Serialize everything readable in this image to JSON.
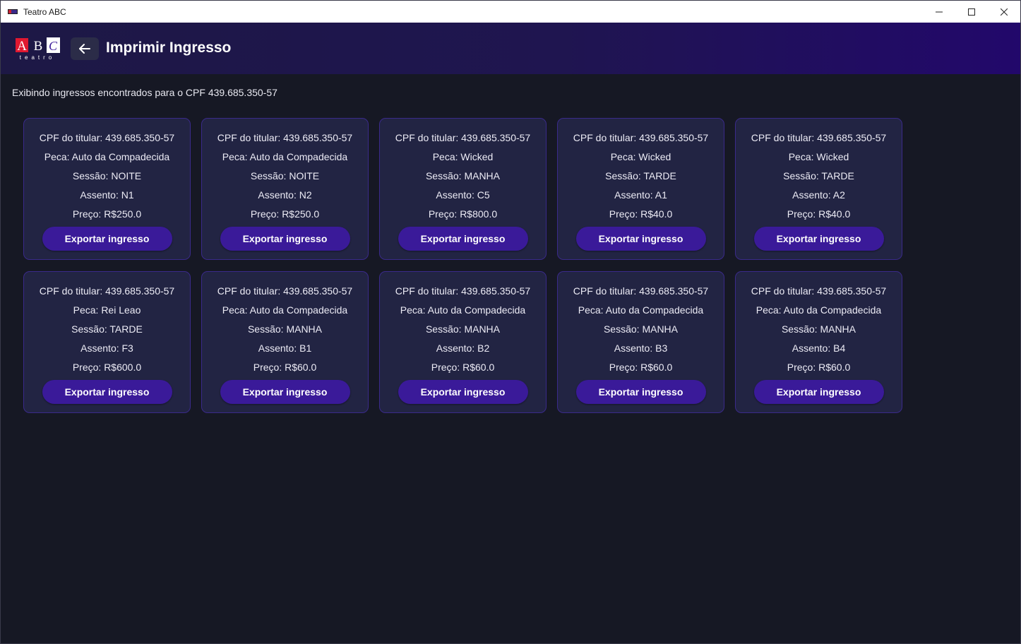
{
  "window": {
    "title": "Teatro ABC"
  },
  "header": {
    "title": "Imprimir Ingresso",
    "logo_text": "ABC teatro"
  },
  "colors": {
    "accent": "#3a1a99",
    "card_bg": "#222443",
    "card_border": "#3a2a8a",
    "background": "#161824"
  },
  "info_text": "Exibindo ingressos encontrados para o CPF 439.685.350-57",
  "tickets": [
    {
      "cpf": "CPF do titular: 439.685.350-57",
      "peca": "Peca: Auto da Compadecida",
      "sessao": "Sessão: NOITE",
      "assento": "Assento: N1",
      "preco": "Preço: R$250.0",
      "button": "Exportar ingresso"
    },
    {
      "cpf": "CPF do titular: 439.685.350-57",
      "peca": "Peca: Auto da Compadecida",
      "sessao": "Sessão: NOITE",
      "assento": "Assento: N2",
      "preco": "Preço: R$250.0",
      "button": "Exportar ingresso"
    },
    {
      "cpf": "CPF do titular: 439.685.350-57",
      "peca": "Peca: Wicked",
      "sessao": "Sessão: MANHA",
      "assento": "Assento: C5",
      "preco": "Preço: R$800.0",
      "button": "Exportar ingresso"
    },
    {
      "cpf": "CPF do titular: 439.685.350-57",
      "peca": "Peca: Wicked",
      "sessao": "Sessão: TARDE",
      "assento": "Assento: A1",
      "preco": "Preço: R$40.0",
      "button": "Exportar ingresso"
    },
    {
      "cpf": "CPF do titular: 439.685.350-57",
      "peca": "Peca: Wicked",
      "sessao": "Sessão: TARDE",
      "assento": "Assento: A2",
      "preco": "Preço: R$40.0",
      "button": "Exportar ingresso"
    },
    {
      "cpf": "CPF do titular: 439.685.350-57",
      "peca": "Peca: Rei Leao",
      "sessao": "Sessão: TARDE",
      "assento": "Assento: F3",
      "preco": "Preço: R$600.0",
      "button": "Exportar ingresso"
    },
    {
      "cpf": "CPF do titular: 439.685.350-57",
      "peca": "Peca: Auto da Compadecida",
      "sessao": "Sessão: MANHA",
      "assento": "Assento: B1",
      "preco": "Preço: R$60.0",
      "button": "Exportar ingresso"
    },
    {
      "cpf": "CPF do titular: 439.685.350-57",
      "peca": "Peca: Auto da Compadecida",
      "sessao": "Sessão: MANHA",
      "assento": "Assento: B2",
      "preco": "Preço: R$60.0",
      "button": "Exportar ingresso"
    },
    {
      "cpf": "CPF do titular: 439.685.350-57",
      "peca": "Peca: Auto da Compadecida",
      "sessao": "Sessão: MANHA",
      "assento": "Assento: B3",
      "preco": "Preço: R$60.0",
      "button": "Exportar ingresso"
    },
    {
      "cpf": "CPF do titular: 439.685.350-57",
      "peca": "Peca: Auto da Compadecida",
      "sessao": "Sessão: MANHA",
      "assento": "Assento: B4",
      "preco": "Preço: R$60.0",
      "button": "Exportar ingresso"
    }
  ]
}
